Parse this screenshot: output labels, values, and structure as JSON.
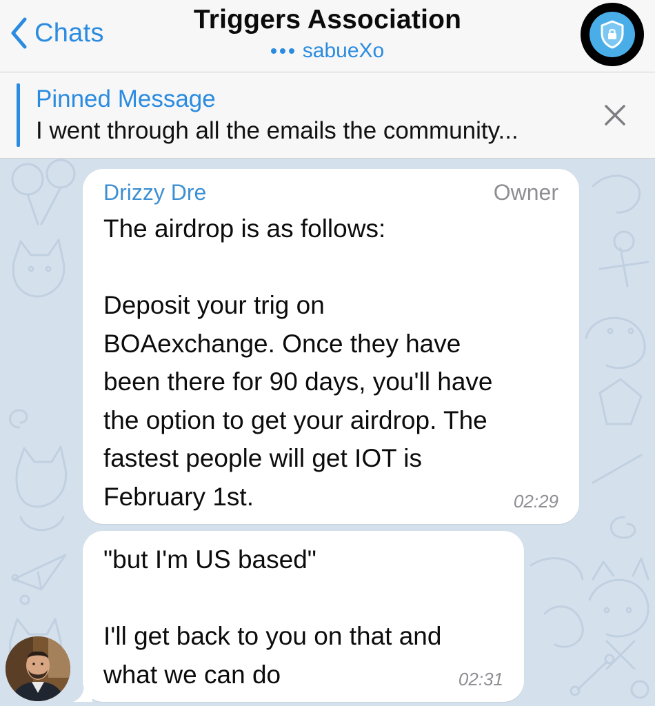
{
  "nav": {
    "back_label": "Chats",
    "title": "Triggers Association",
    "subtitle": "sabueXo",
    "typing_indicator": "typing-dots",
    "avatar_icon": "shield-lock-icon",
    "accent_color": "#2a8be0"
  },
  "pinned": {
    "title": "Pinned Message",
    "text": "I went through all the emails the community...",
    "close_icon": "close-icon"
  },
  "chat": {
    "background_color": "#d4e0ec",
    "messages": [
      {
        "sender": "Drizzy Dre",
        "role": "Owner",
        "text": "The airdrop is as follows:\n\nDeposit your trig on\nBOAexchange. Once they have\nbeen there for 90 days, you'll have\nthe option to get your airdrop. The\nfastest people will get IOT is\nFebruary 1st.",
        "time": "02:29"
      },
      {
        "text": "\"but I'm US based\"\n\nI'll get back to you on that and\nwhat we can do",
        "time": "02:31"
      }
    ]
  }
}
